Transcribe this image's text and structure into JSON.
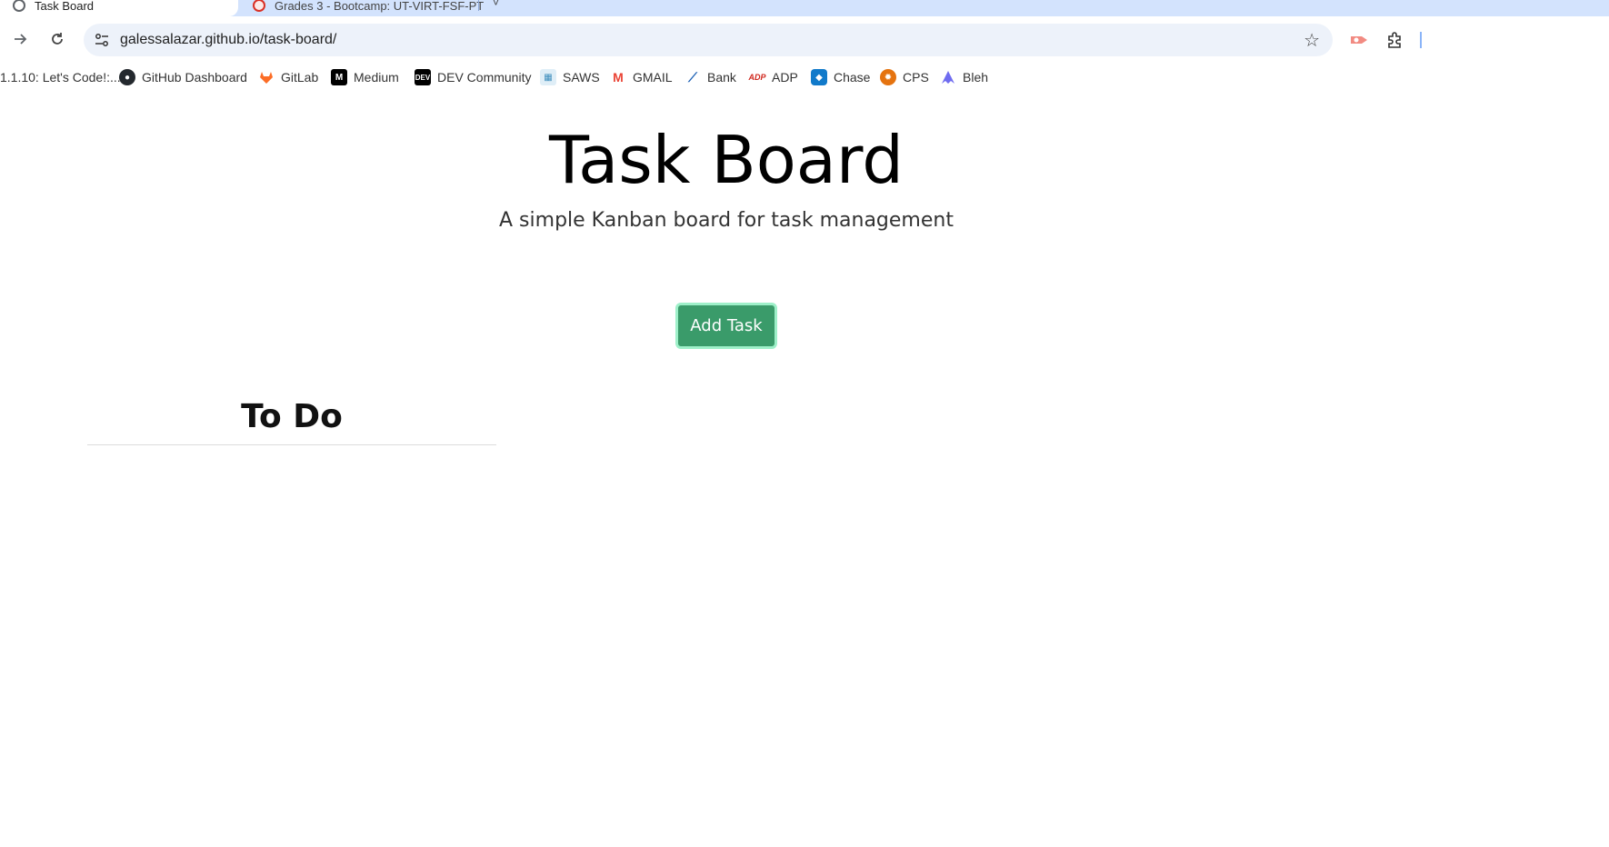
{
  "browser": {
    "tabs": [
      {
        "label": "Task Board",
        "active": true
      },
      {
        "label": "Grades 3 - Bootcamp: UT-VIRT-FSF-PT",
        "active": false
      }
    ],
    "url": "galessalazar.github.io/task-board/"
  },
  "bookmarks": [
    {
      "label": "1.1.10: Let's Code!:...",
      "icon": "lets-code-icon"
    },
    {
      "label": "GitHub Dashboard",
      "icon": "github-icon",
      "color": "#24292e"
    },
    {
      "label": "GitLab",
      "icon": "gitlab-icon",
      "color": "#fc6d26"
    },
    {
      "label": "Medium",
      "icon": "medium-icon",
      "color": "#000000"
    },
    {
      "label": "DEV Community",
      "icon": "dev-icon",
      "color": "#000000"
    },
    {
      "label": "SAWS",
      "icon": "saws-icon",
      "color": "#3c8dbc"
    },
    {
      "label": "GMAIL",
      "icon": "gmail-icon",
      "color": "#ea4335"
    },
    {
      "label": "Bank",
      "icon": "bank-icon",
      "color": "#1a5fb4"
    },
    {
      "label": "ADP",
      "icon": "adp-icon",
      "color": "#d0271d"
    },
    {
      "label": "Chase",
      "icon": "chase-icon",
      "color": "#117aca"
    },
    {
      "label": "CPS",
      "icon": "cps-icon",
      "color": "#e5730f"
    },
    {
      "label": "Bleh",
      "icon": "bleh-icon",
      "color": "#6f6cf0"
    }
  ],
  "page": {
    "title": "Task Board",
    "subtitle": "A simple Kanban board for task management",
    "add_button": "Add Task",
    "columns": [
      {
        "title": "To Do"
      }
    ]
  },
  "colors": {
    "accent": "#3a9b6a",
    "accent_outline": "#9ef0c9"
  }
}
